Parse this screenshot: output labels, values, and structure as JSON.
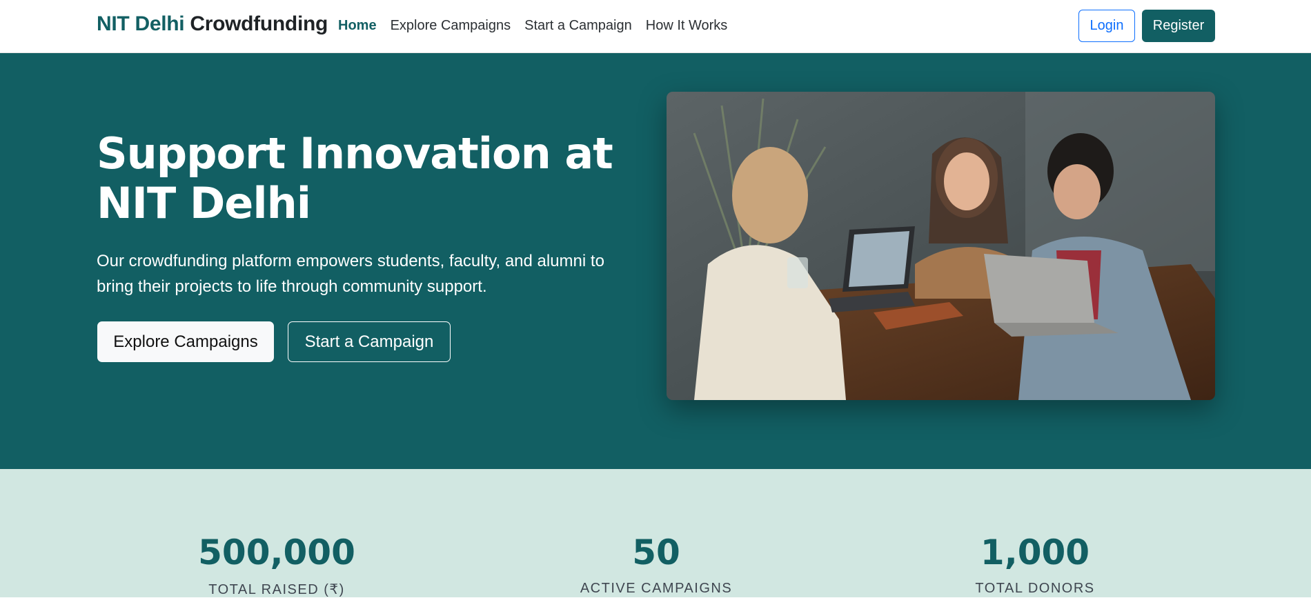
{
  "navbar": {
    "brand_accent": "NIT Delhi",
    "brand_rest": "Crowdfunding",
    "links": [
      "Home",
      "Explore Campaigns",
      "Start a Campaign",
      "How It Works"
    ],
    "login_label": "Login",
    "register_label": "Register"
  },
  "hero": {
    "title": "Support Innovation at NIT Delhi",
    "description": "Our crowdfunding platform empowers students, faculty, and alumni to bring their projects to life through community support.",
    "primary_button": "Explore Campaigns",
    "secondary_button": "Start a Campaign"
  },
  "stats": [
    {
      "value": "500,000",
      "label": "TOTAL RAISED (₹)"
    },
    {
      "value": "50",
      "label": "ACTIVE CAMPAIGNS"
    },
    {
      "value": "1,000",
      "label": "TOTAL DONORS"
    }
  ],
  "colors": {
    "brand": "#125f63",
    "stats_bg": "#d1e7e1",
    "link_blue": "#0d6efd"
  }
}
